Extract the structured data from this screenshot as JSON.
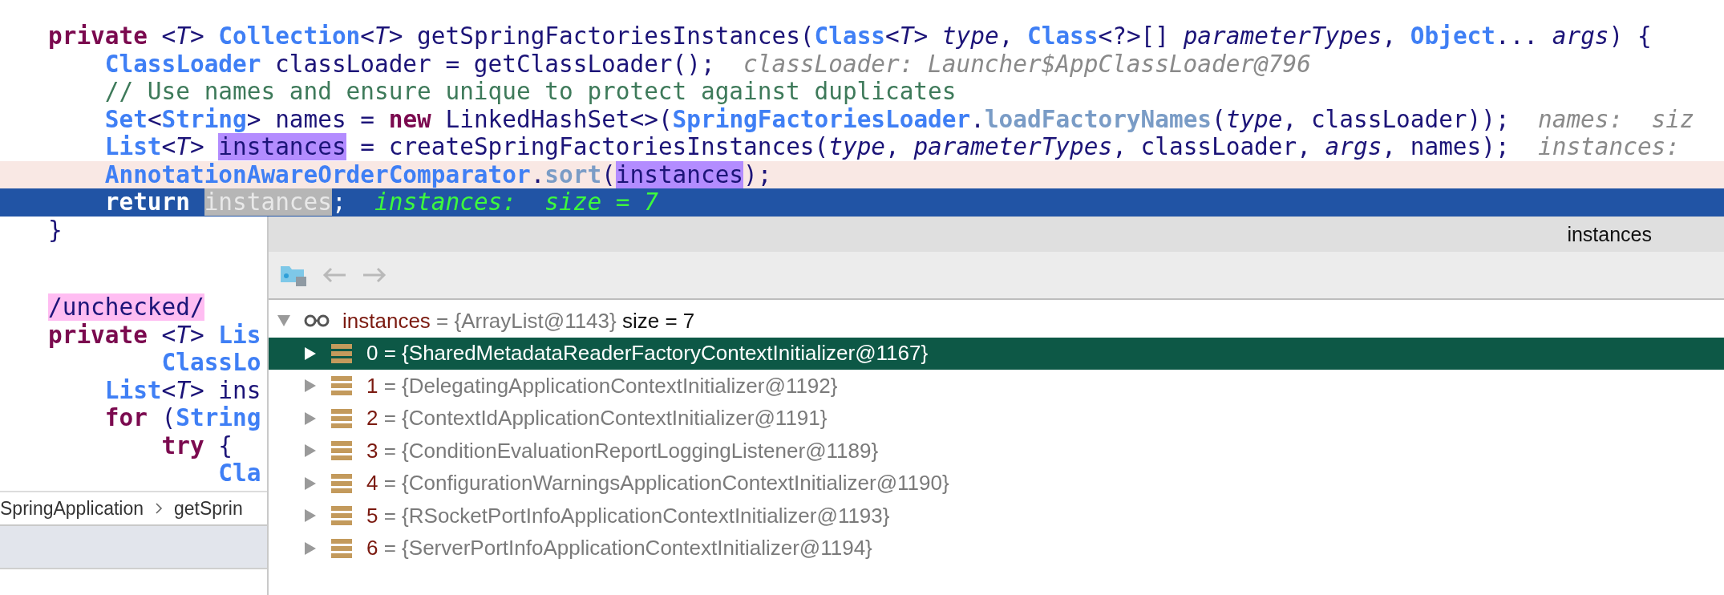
{
  "editor": {
    "lines": [
      {
        "kind": "plain",
        "tokens": [
          {
            "kind": "keyword",
            "text": "private"
          },
          {
            "kind": "plain",
            "text": " <"
          },
          {
            "kind": "italic",
            "text": "T"
          },
          {
            "kind": "plain",
            "text": "> "
          },
          {
            "kind": "type",
            "text": "Collection"
          },
          {
            "kind": "plain",
            "text": "<"
          },
          {
            "kind": "italic",
            "text": "T"
          },
          {
            "kind": "plain",
            "text": "> getSpringFactoriesInstances("
          },
          {
            "kind": "type",
            "text": "Class"
          },
          {
            "kind": "plain",
            "text": "<"
          },
          {
            "kind": "italic",
            "text": "T"
          },
          {
            "kind": "plain",
            "text": "> "
          },
          {
            "kind": "italic",
            "text": "type"
          },
          {
            "kind": "plain",
            "text": ", "
          },
          {
            "kind": "type",
            "text": "Class"
          },
          {
            "kind": "plain",
            "text": "<?>[] "
          },
          {
            "kind": "italic",
            "text": "parameterTypes"
          },
          {
            "kind": "plain",
            "text": ", "
          },
          {
            "kind": "type",
            "text": "Object"
          },
          {
            "kind": "plain",
            "text": "... "
          },
          {
            "kind": "italic",
            "text": "args"
          },
          {
            "kind": "plain",
            "text": ") {"
          }
        ]
      },
      {
        "kind": "plain",
        "tokens": [
          {
            "kind": "type",
            "text": "    ClassLoader"
          },
          {
            "kind": "plain",
            "text": " classLoader = getClassLoader();"
          },
          {
            "kind": "hint",
            "text": "  classLoader: Launcher$AppClassLoader@796"
          }
        ]
      },
      {
        "kind": "plain",
        "tokens": [
          {
            "kind": "comment",
            "text": "    // Use names and ensure unique to protect against duplicates"
          }
        ]
      },
      {
        "kind": "plain",
        "tokens": [
          {
            "kind": "type",
            "text": "    Set"
          },
          {
            "kind": "plain",
            "text": "<"
          },
          {
            "kind": "type",
            "text": "String"
          },
          {
            "kind": "plain",
            "text": "> names = "
          },
          {
            "kind": "keyword",
            "text": "new"
          },
          {
            "kind": "plain",
            "text": " LinkedHashSet<>("
          },
          {
            "kind": "type",
            "text": "SpringFactoriesLoader"
          },
          {
            "kind": "plain",
            "text": "."
          },
          {
            "kind": "static",
            "text": "loadFactoryNames"
          },
          {
            "kind": "plain",
            "text": "("
          },
          {
            "kind": "italic",
            "text": "type"
          },
          {
            "kind": "plain",
            "text": ", classLoader));"
          },
          {
            "kind": "hint",
            "text": "  names:  siz"
          }
        ]
      },
      {
        "kind": "plain",
        "tokens": [
          {
            "kind": "type",
            "text": "    List"
          },
          {
            "kind": "plain",
            "text": "<"
          },
          {
            "kind": "italic",
            "text": "T"
          },
          {
            "kind": "plain",
            "text": "> "
          },
          {
            "kind": "usage",
            "text": "instances"
          },
          {
            "kind": "plain",
            "text": " = createSpringFactoriesInstances("
          },
          {
            "kind": "italic",
            "text": "type"
          },
          {
            "kind": "plain",
            "text": ", "
          },
          {
            "kind": "italic",
            "text": "parameterTypes"
          },
          {
            "kind": "plain",
            "text": ", classLoader, "
          },
          {
            "kind": "italic",
            "text": "args"
          },
          {
            "kind": "plain",
            "text": ", names);"
          },
          {
            "kind": "hint",
            "text": "  instances:"
          }
        ]
      },
      {
        "kind": "breakpoint",
        "tokens": [
          {
            "kind": "type",
            "text": "    AnnotationAwareOrderComparator"
          },
          {
            "kind": "plain",
            "text": "."
          },
          {
            "kind": "static",
            "text": "sort"
          },
          {
            "kind": "plain",
            "text": "("
          },
          {
            "kind": "usage",
            "text": "instances"
          },
          {
            "kind": "plain",
            "text": ");"
          }
        ]
      },
      {
        "kind": "current",
        "tokens": [
          {
            "kind": "keyword",
            "text": "    return "
          },
          {
            "kind": "selection",
            "text": "instances"
          },
          {
            "kind": "plain",
            "text": ";"
          },
          {
            "kind": "hint",
            "text": "  instances:  size = 7"
          }
        ]
      },
      {
        "kind": "plain",
        "tokens": [
          {
            "kind": "plain",
            "text": "}"
          }
        ]
      },
      {
        "kind": "plain"
      },
      {
        "kind": "plain",
        "tokens": [
          {
            "kind": "annotation",
            "text": "/unchecked/"
          }
        ]
      },
      {
        "kind": "plain",
        "tokens": [
          {
            "kind": "keyword",
            "text": "private"
          },
          {
            "kind": "plain",
            "text": " <"
          },
          {
            "kind": "italic",
            "text": "T"
          },
          {
            "kind": "plain",
            "text": "> "
          },
          {
            "kind": "type",
            "text": "Lis"
          }
        ]
      },
      {
        "kind": "plain",
        "tokens": [
          {
            "kind": "type",
            "text": "        ClassLo"
          }
        ]
      },
      {
        "kind": "plain",
        "tokens": [
          {
            "kind": "type",
            "text": "    List"
          },
          {
            "kind": "plain",
            "text": "<"
          },
          {
            "kind": "italic",
            "text": "T"
          },
          {
            "kind": "plain",
            "text": "> ins"
          }
        ]
      },
      {
        "kind": "plain",
        "tokens": [
          {
            "kind": "keyword",
            "text": "    for"
          },
          {
            "kind": "plain",
            "text": " ("
          },
          {
            "kind": "type",
            "text": "String"
          }
        ]
      },
      {
        "kind": "plain",
        "tokens": [
          {
            "kind": "keyword",
            "text": "        try"
          },
          {
            "kind": "plain",
            "text": " {"
          }
        ]
      },
      {
        "kind": "plain",
        "tokens": [
          {
            "kind": "type",
            "text": "            Cla"
          }
        ]
      }
    ]
  },
  "breadcrumbs": [
    "SpringApplication",
    "getSprin"
  ],
  "popup": {
    "title": "instances",
    "root": {
      "name": "instances",
      "value": "= {ArrayList@1143}",
      "extra": "size = 7",
      "expanded": true,
      "children": [
        {
          "name": "0",
          "value": "= {SharedMetadataReaderFactoryContextInitializer@1167}",
          "selected": true,
          "expanded": false
        },
        {
          "name": "1",
          "value": "= {DelegatingApplicationContextInitializer@1192}",
          "selected": false,
          "expanded": false
        },
        {
          "name": "2",
          "value": "= {ContextIdApplicationContextInitializer@1191}",
          "selected": false,
          "expanded": false
        },
        {
          "name": "3",
          "value": "= {ConditionEvaluationReportLoggingListener@1189}",
          "selected": false,
          "expanded": false
        },
        {
          "name": "4",
          "value": "= {ConfigurationWarningsApplicationContextInitializer@1190}",
          "selected": false,
          "expanded": false
        },
        {
          "name": "5",
          "value": "= {RSocketPortInfoApplicationContextInitializer@1193}",
          "selected": false,
          "expanded": false
        },
        {
          "name": "6",
          "value": "= {ServerPortInfoApplicationContextInitializer@1194}",
          "selected": false,
          "expanded": false
        }
      ]
    }
  }
}
